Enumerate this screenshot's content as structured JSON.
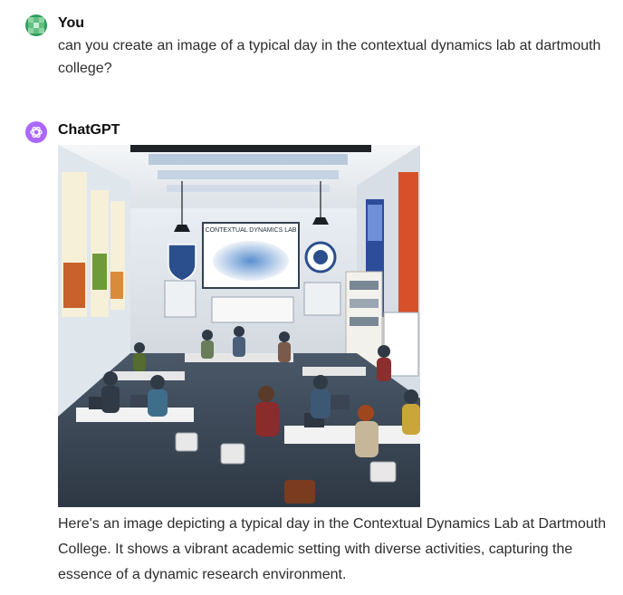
{
  "user_message": {
    "author": "You",
    "text": "can you create an image of a typical day in the contextual dynamics lab at dartmouth college?"
  },
  "assistant_message": {
    "author": "ChatGPT",
    "image": {
      "wall_sign": "CONTEXTUAL DYNAMICS LAB"
    },
    "text": "Here's an image depicting a typical day in the Contextual Dynamics Lab at Dartmouth College. It shows a vibrant academic setting with diverse activities, capturing the essence of a dynamic research environment."
  },
  "colors": {
    "user_avatar": "#2f9e5c",
    "assistant_avatar": "#ab68ff",
    "text": "#2d2d2d"
  },
  "icons": {
    "user_avatar": "grid-avatar-icon",
    "assistant_avatar": "openai-logo-icon"
  }
}
